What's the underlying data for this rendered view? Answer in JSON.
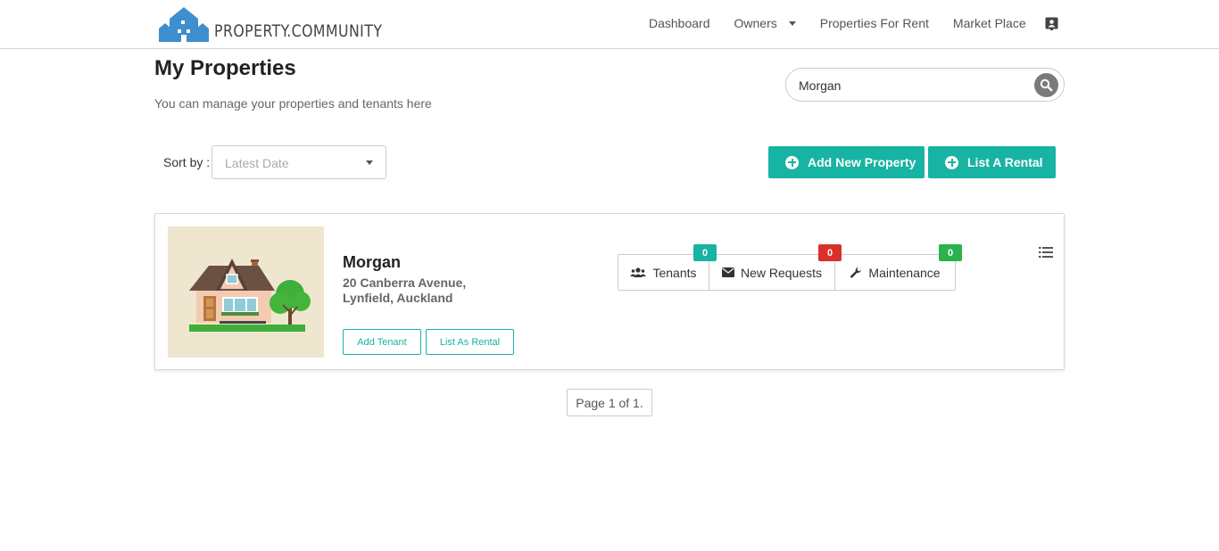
{
  "header": {
    "logo_text": "PROPERTY.COMMUNITY",
    "nav": {
      "dashboard": "Dashboard",
      "owners": "Owners",
      "properties_for_rent": "Properties For Rent",
      "market_place": "Market Place"
    },
    "profile_icon": "contact-card-icon"
  },
  "page": {
    "title": "My Properties",
    "subtitle": "You can manage your properties and tenants here"
  },
  "search": {
    "value": "Morgan",
    "icon": "search-icon"
  },
  "sort": {
    "label": "Sort by :",
    "selected": "Latest Date"
  },
  "actions": {
    "add_property": "Add New Property",
    "list_rental": "List A Rental"
  },
  "properties": [
    {
      "name": "Morgan",
      "address_line1": "20 Canberra Avenue,",
      "address_line2": "Lynfield, Auckland",
      "add_tenant_label": "Add Tenant",
      "list_as_rental_label": "List As Rental",
      "stats": {
        "tenants": {
          "label": "Tenants",
          "count": "0",
          "color": "#17b3a3"
        },
        "new_requests": {
          "label": "New Requests",
          "count": "0",
          "color": "#d9302b"
        },
        "maintenance": {
          "label": "Maintenance",
          "count": "0",
          "color": "#2bb24c"
        }
      }
    }
  ],
  "pagination": {
    "label": "Page 1 of 1."
  },
  "colors": {
    "accent": "#17b3a3",
    "logo_blue": "#3d8fcf"
  }
}
